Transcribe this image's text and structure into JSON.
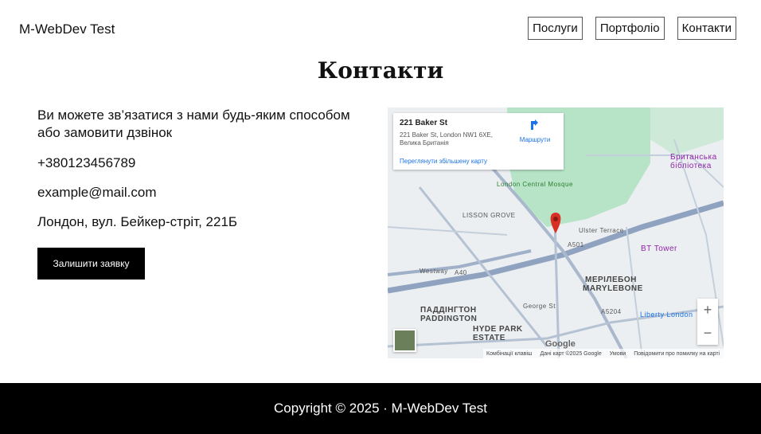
{
  "header": {
    "brand": "M-WebDev Test",
    "nav": [
      "Послуги",
      "Портфоліо",
      "Контакти"
    ]
  },
  "page_title": "Контакти",
  "contacts": {
    "intro": "Ви можете зв’язатися з нами будь-яким способом або замовити дзвінок",
    "phone": "+380123456789",
    "email": "example@mail.com",
    "address": "Лондон, вул. Бейкер-стріт, 221Б",
    "cta_label": "Залишити заявку"
  },
  "map": {
    "popup_title": "221 Baker St",
    "popup_address": "221 Baker St, London NW1 6XE, Велика Британія",
    "directions_label": "Маршрути",
    "view_larger": "Переглянути збільшену карту",
    "labels": {
      "mosque": "London Central Mosque",
      "lisson": "LISSON GROVE",
      "marylebone_ua": "МЕРІЛЕБОН",
      "marylebone_en": "MARYLEBONE",
      "paddington_ua": "ПАДДІНГТОН",
      "paddington_en": "PADDINGTON",
      "hyde_park_estate": "HYDE PARK\nESTATE",
      "bt_tower": "BT Tower",
      "british_museum": "Британська бібліотека",
      "liberty": "Liberty London",
      "westway": "Westway",
      "a40": "A40",
      "a501": "A501",
      "ulster": "Ulster Terrace",
      "george": "George St",
      "a5204": "A5204"
    },
    "zoom_in": "+",
    "zoom_out": "−",
    "footer": [
      "Комбінації клавіш",
      "Дані карт ©2025 Google",
      "Умови",
      "Повідомити про помилку на карті"
    ],
    "logo": "Google"
  },
  "footer": {
    "copyright": "Copyright © 2025 · M-WebDev Test"
  },
  "colors": {
    "footer_bg": "#000000",
    "cta_bg": "#000000",
    "map_pin": "#d93025",
    "map_park": "#b7e4c7",
    "map_road": "#8fa3c0"
  }
}
